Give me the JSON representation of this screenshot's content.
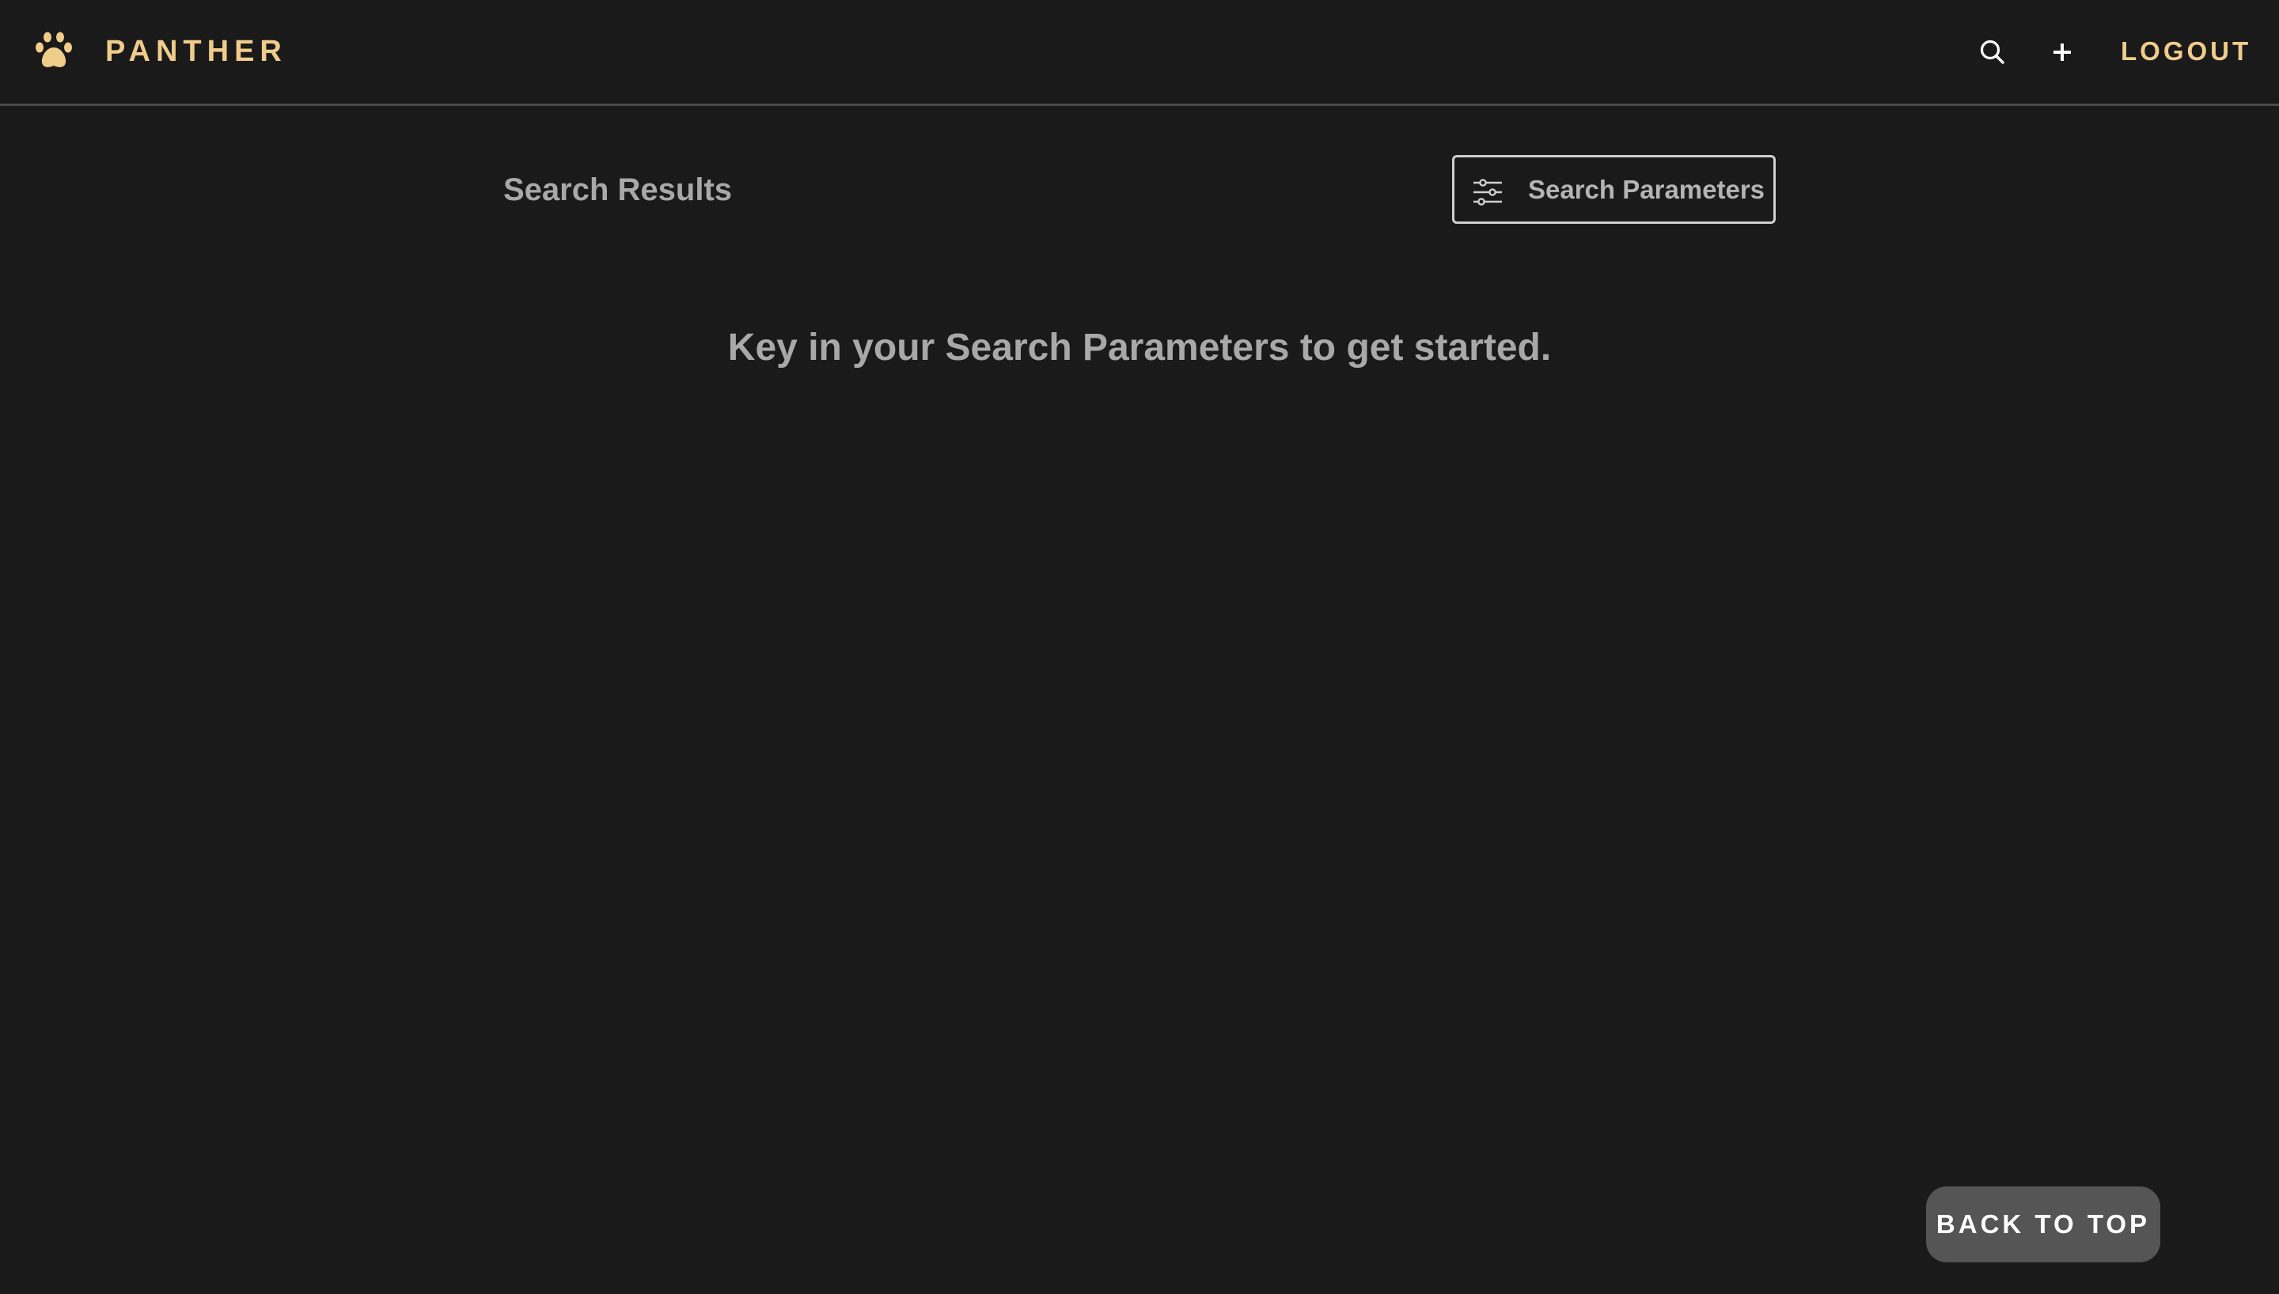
{
  "app": {
    "brand_name": "PANTHER",
    "logo_icon": "paw-icon",
    "accent_color": "#f0cc8a"
  },
  "header": {
    "search_icon": "search-icon",
    "add_icon": "plus-icon",
    "logout_label": "LOGOUT"
  },
  "main": {
    "title": "Search Results",
    "params_button": {
      "icon": "sliders-icon",
      "label": "Search Parameters"
    },
    "empty_message": "Key in your Search Parameters to get started."
  },
  "footer": {
    "back_to_top_label": "BACK TO TOP"
  },
  "colors": {
    "background": "#1a1a1a",
    "muted_text": "#a8a8a8",
    "button_gray": "#555555"
  }
}
